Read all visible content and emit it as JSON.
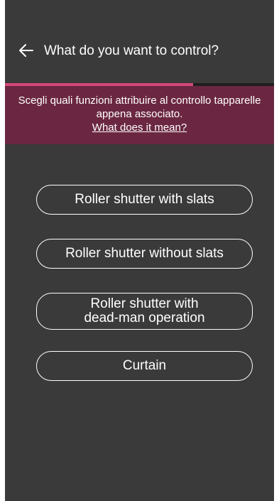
{
  "header": {
    "back_icon": "arrow-left-icon",
    "title": "What do you want to control?"
  },
  "progress": {
    "value": 0.7,
    "accent_color": "#d6487a"
  },
  "banner": {
    "text": "Scegli quali funzioni attribuire al controllo tapparelle appena associato.",
    "link": "What does it mean?",
    "background_color": "#6b2741"
  },
  "options": [
    {
      "label": "Roller shutter with slats"
    },
    {
      "label": "Roller shutter without slats"
    },
    {
      "label_line1": "Roller shutter with",
      "label_line2": "dead-man operation"
    },
    {
      "label": "Curtain"
    }
  ]
}
